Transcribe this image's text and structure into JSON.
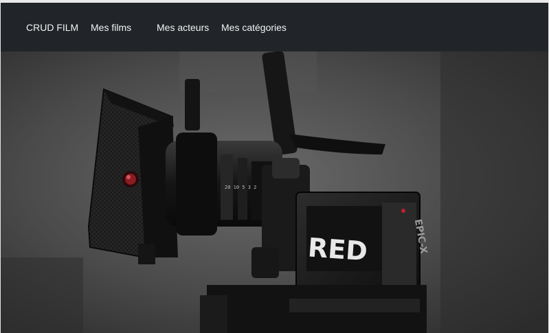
{
  "navbar": {
    "brand": "CRUD FILM",
    "links": [
      "Mes films",
      "Mes acteurs",
      "Mes catégories"
    ],
    "background": "#212529",
    "text_color": "#f2f2f2"
  },
  "hero": {
    "camera_label": "RED",
    "camera_side_label": "EPIC-X",
    "lens_text": "20 10 5 3 2",
    "accent_color": "#c0202a"
  }
}
